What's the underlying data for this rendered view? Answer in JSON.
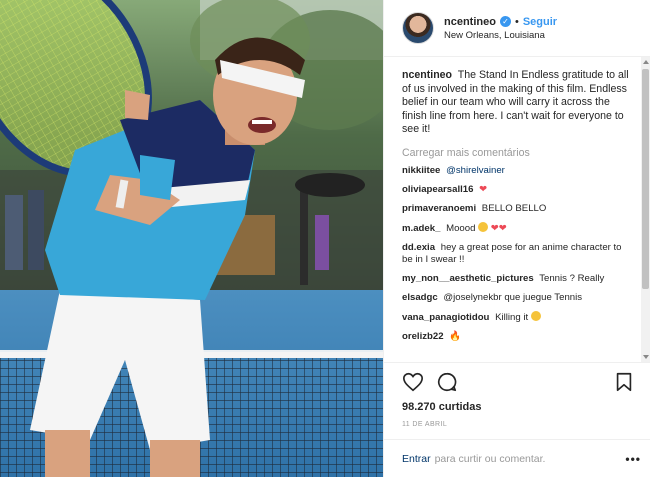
{
  "post": {
    "username": "ncentineo",
    "verified_icon": "verified-badge-icon",
    "separator": "•",
    "follow_label": "Seguir",
    "location": "New Orleans, Louisiana",
    "caption_user": "ncentineo",
    "caption_text": "The Stand In Endless gratitude to all of us involved in the making of this film. Endless belief in our team who will carry it across the finish line from here. I can't wait for everyone to see it!",
    "load_more": "Carregar mais comentários",
    "likes": "98.270 curtidas",
    "date": "11 de abril",
    "add_comment": {
      "enter_label": "Entrar",
      "placeholder": "para curtir ou comentar.",
      "more_label": "•••"
    }
  },
  "comments": [
    {
      "user": "nikkiitee",
      "text": "@shirelvainer"
    },
    {
      "user": "oliviapearsall16",
      "text": "❤"
    },
    {
      "user": "primaveranoemi",
      "text": "BELLO BELLO"
    },
    {
      "user": "m.adek_",
      "text": "Moood"
    },
    {
      "user": "dd.exia",
      "text": "hey a great pose for an anime character to be in I swear !!"
    },
    {
      "user": "my_non__aesthetic_pictures",
      "text": "Tennis ? Really"
    },
    {
      "user": "elsadgc",
      "text": "@joselynekbr que juegue Tennis"
    },
    {
      "user": "vana_panagiotidou",
      "text": "Killing it"
    },
    {
      "user": "orelizb22",
      "text": "🔥"
    }
  ],
  "colors": {
    "accent": "#3897f0",
    "mention": "#003569",
    "heart": "#ed4956",
    "muted": "#999999"
  }
}
